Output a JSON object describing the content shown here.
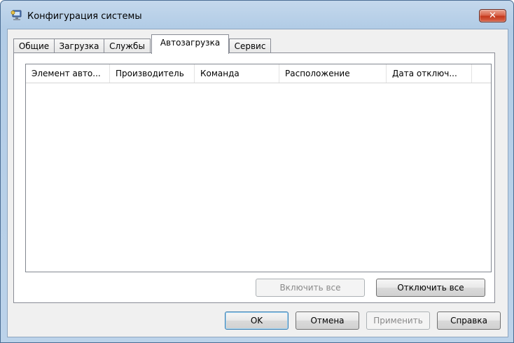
{
  "window": {
    "title": "Конфигурация системы",
    "close_label": "✕"
  },
  "tabs": [
    {
      "label": "Общие",
      "active": false
    },
    {
      "label": "Загрузка",
      "active": false
    },
    {
      "label": "Службы",
      "active": false
    },
    {
      "label": "Автозагрузка",
      "active": true
    },
    {
      "label": "Сервис",
      "active": false
    }
  ],
  "startup_list": {
    "columns": [
      "Элемент авто...",
      "Производитель",
      "Команда",
      "Расположение",
      "Дата отключ..."
    ],
    "rows": []
  },
  "panel_buttons": {
    "enable_all": "Включить все",
    "disable_all": "Отключить все"
  },
  "dialog_buttons": {
    "ok": "OK",
    "cancel": "Отмена",
    "apply": "Применить",
    "help": "Справка"
  },
  "colors": {
    "titlebar": "#b2cce6",
    "close_button": "#c4381c",
    "client_background": "#f0f0f0"
  }
}
